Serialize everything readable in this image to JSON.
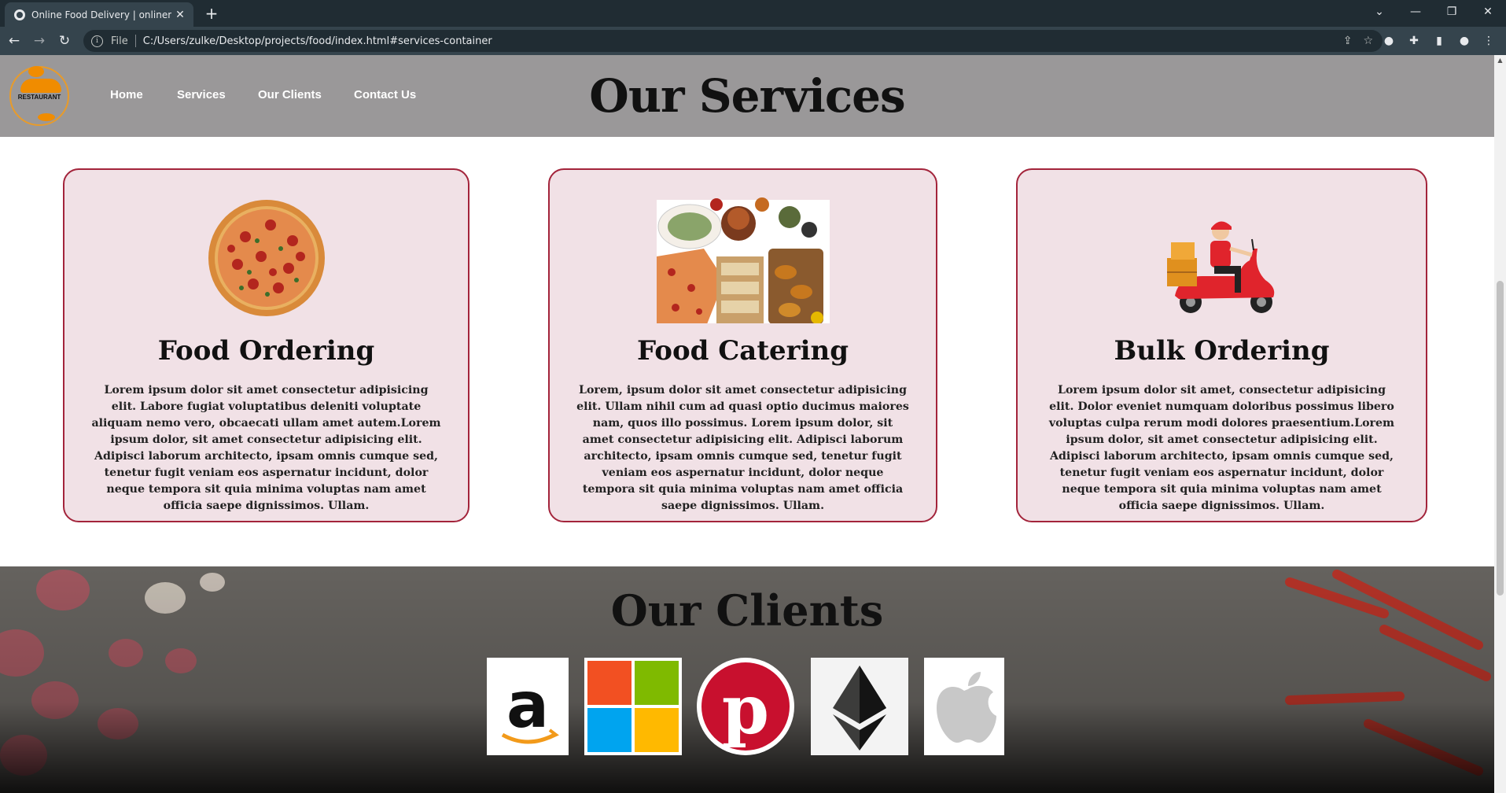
{
  "browser": {
    "tab_title": "Online Food Delivery | onlinemea",
    "file_label": "File",
    "url": "C:/Users/zulke/Desktop/projects/food/index.html#services-container"
  },
  "site": {
    "logo_text": "RESTAURANT",
    "nav": [
      "Home",
      "Services",
      "Our Clients",
      "Contact Us"
    ],
    "services_title": "Our Services",
    "services": [
      {
        "title": "Food Ordering",
        "image": "pizza",
        "text": "Lorem ipsum dolor sit amet consectetur adipisicing elit. Labore fugiat voluptatibus deleniti voluptate aliquam nemo vero, obcaecati ullam amet autem.Lorem ipsum dolor, sit amet consectetur adipisicing elit. Adipisci laborum architecto, ipsam omnis cumque sed, tenetur fugit veniam eos aspernatur incidunt, dolor neque tempora sit quia minima voluptas nam amet officia saepe dignissimos. Ullam."
      },
      {
        "title": "Food Catering",
        "image": "catering-spread",
        "text": "Lorem, ipsum dolor sit amet consectetur adipisicing elit. Ullam nihil cum ad quasi optio ducimus maiores nam, quos illo possimus. Lorem ipsum dolor, sit amet consectetur adipisicing elit. Adipisci laborum architecto, ipsam omnis cumque sed, tenetur fugit veniam eos aspernatur incidunt, dolor neque tempora sit quia minima voluptas nam amet officia saepe dignissimos. Ullam."
      },
      {
        "title": "Bulk Ordering",
        "image": "delivery-scooter",
        "text": "Lorem ipsum dolor sit amet, consectetur adipisicing elit. Dolor eveniet numquam doloribus possimus libero voluptas culpa rerum modi dolores praesentium.Lorem ipsum dolor, sit amet consectetur adipisicing elit. Adipisci laborum architecto, ipsam omnis cumque sed, tenetur fugit veniam eos aspernatur incidunt, dolor neque tempora sit quia minima voluptas nam amet officia saepe dignissimos. Ullam."
      }
    ],
    "clients_title": "Our Clients",
    "clients": [
      "amazon-logo",
      "microsoft-logo",
      "pinterest-logo",
      "ethereum-logo",
      "apple-logo"
    ]
  },
  "colors": {
    "header_bg": "#9a9899",
    "card_bg": "#f1e1e6",
    "card_border": "#a3243b"
  }
}
